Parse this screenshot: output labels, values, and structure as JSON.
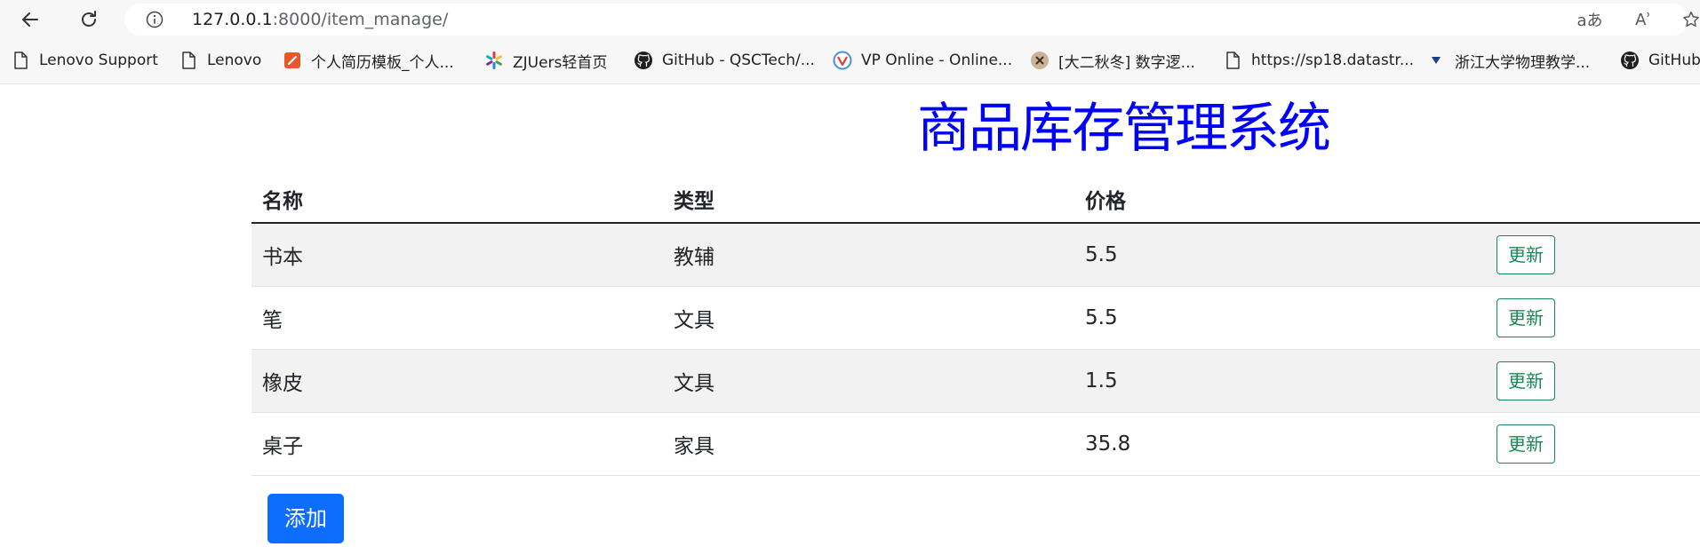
{
  "browser": {
    "url_host": "127.0.0.1",
    "url_rest": ":8000/item_manage/",
    "icons": [
      "back-arrow-icon",
      "reload-icon",
      "info-icon",
      "translate-icon",
      "read-aloud-icon",
      "favorite-star-icon"
    ],
    "translate_glyph": "aあ",
    "read_aloud_glyph": "Aʾ"
  },
  "bookmarks": [
    {
      "label": "Lenovo Support",
      "icon": "page-icon"
    },
    {
      "label": "Lenovo",
      "icon": "page-icon"
    },
    {
      "label": "个人简历模板_个人...",
      "icon": "resume-icon"
    },
    {
      "label": "ZJUers轻首页",
      "icon": "pinwheel-icon"
    },
    {
      "label": "GitHub - QSCTech/...",
      "icon": "github-icon"
    },
    {
      "label": "VP Online - Online...",
      "icon": "vp-online-icon"
    },
    {
      "label": "[大二秋冬] 数字逻...",
      "icon": "course-avatar-icon"
    },
    {
      "label": "https://sp18.datastr...",
      "icon": "page-icon"
    },
    {
      "label": "浙江大学物理教学...",
      "icon": "triangle-icon"
    },
    {
      "label": "GitHub",
      "icon": "github-icon"
    }
  ],
  "page": {
    "title": "商品库存管理系统",
    "table": {
      "headers": [
        "名称",
        "类型",
        "价格",
        ""
      ],
      "rows": [
        {
          "name": "书本",
          "type": "教辅",
          "price": "5.5",
          "action": "更新"
        },
        {
          "name": "笔",
          "type": "文具",
          "price": "5.5",
          "action": "更新"
        },
        {
          "name": "橡皮",
          "type": "文具",
          "price": "1.5",
          "action": "更新"
        },
        {
          "name": "桌子",
          "type": "家具",
          "price": "35.8",
          "action": "更新"
        }
      ]
    },
    "add_button": "添加"
  },
  "colors": {
    "title": "#0000ff",
    "update_button": "#198754",
    "add_button": "#0d6efd",
    "striped_row": "#f2f2f2"
  }
}
